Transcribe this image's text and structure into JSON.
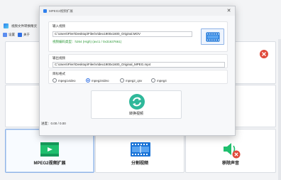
{
  "app": {
    "title": "视频文件转换精灵",
    "menu": [
      {
        "label": "设置"
      },
      {
        "label": "关于"
      }
    ]
  },
  "cards": [
    {
      "label": "MPEG2视频扩展",
      "selected": true
    },
    {
      "label": "分割视频",
      "selected": false
    },
    {
      "label": "移除声音",
      "selected": false
    }
  ],
  "dialog": {
    "title": "MPEG2视频扩展",
    "input_label": "输入视频",
    "input_path": "C:\\Users\\Flerr\\Desktop\\Files\\Video1900x1600_Original.MOV",
    "input_info": "视频编码类型：h264 (High) (avc1 / 0x31637661)",
    "output_label": "输出视频",
    "output_path": "C:\\Users\\Flerr\\Desktop\\Files\\Video1900x1600_Original_MPEG.mp4",
    "encoder_label": "目标格式",
    "encoders": [
      {
        "label": "mpeg1video",
        "checked": false
      },
      {
        "label": "mpeg2video",
        "checked": true
      },
      {
        "label": "mpeg2_qsv",
        "checked": false
      },
      {
        "label": "mpeg4",
        "checked": false
      }
    ],
    "convert_label": "转换视频",
    "progress": "进度：0.00 / 0.00"
  },
  "colors": {
    "accent": "#2f6fe4",
    "convert": "#2fb89a",
    "info_green": "#2f9a3a",
    "card_selected_border": "#8fb3e6"
  }
}
